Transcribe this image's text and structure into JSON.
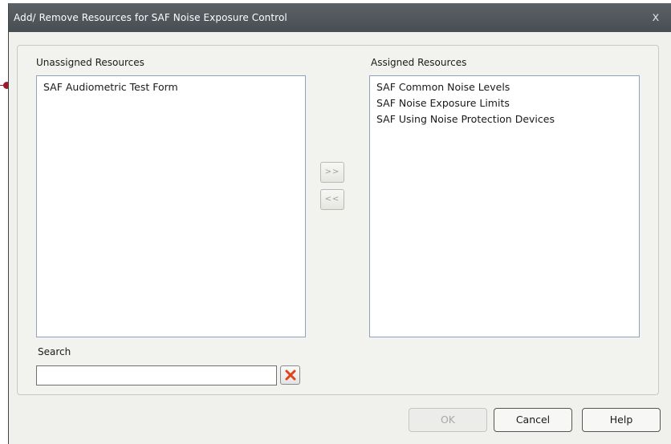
{
  "dialog": {
    "title": "Add/ Remove Resources for SAF  Noise Exposure Control",
    "close_glyph": "x"
  },
  "unassigned": {
    "label": "Unassigned Resources",
    "items": [
      "SAF  Audiometric Test Form"
    ]
  },
  "assigned": {
    "label": "Assigned Resources",
    "items": [
      "SAF  Common Noise Levels",
      "SAF  Noise Exposure Limits",
      "SAF  Using Noise Protection Devices"
    ]
  },
  "transfer": {
    "add_label": ">>",
    "remove_label": "<<"
  },
  "search": {
    "label": "Search",
    "value": "",
    "clear_icon": "red-x-icon"
  },
  "buttons": {
    "ok": "OK",
    "cancel": "Cancel",
    "help": "Help"
  },
  "colors": {
    "titlebar": "#4f565b",
    "marker": "#9b1b2a",
    "list_border": "#8fa3bf",
    "clear_icon": "#e0421a"
  }
}
